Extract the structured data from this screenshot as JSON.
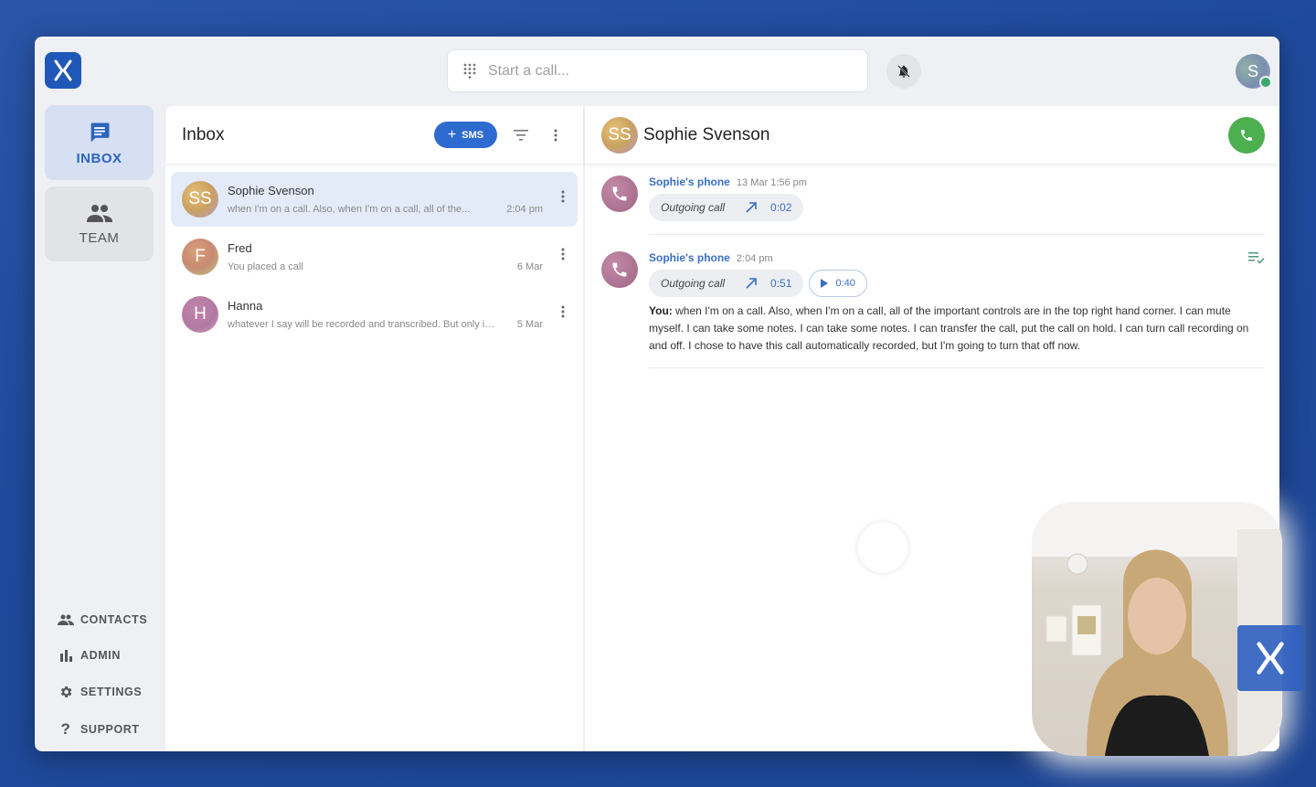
{
  "topbar": {
    "logo_letter": "X",
    "search_placeholder": "Start a call...",
    "user_initial": "S",
    "user_status": "online"
  },
  "colors": {
    "accent": "#2e6bd0",
    "call_green": "#4caf50",
    "presence_green": "#3aa86b",
    "background_blue": "#1f4a9c"
  },
  "nav": {
    "main": [
      {
        "label": "INBOX",
        "icon": "chat-icon",
        "active": true
      },
      {
        "label": "TEAM",
        "icon": "group-icon",
        "active": false
      }
    ],
    "bottom": [
      {
        "label": "CONTACTS",
        "icon": "contacts-icon"
      },
      {
        "label": "ADMIN",
        "icon": "bar-chart-icon"
      },
      {
        "label": "SETTINGS",
        "icon": "gear-icon"
      },
      {
        "label": "SUPPORT",
        "icon": "question-icon"
      }
    ]
  },
  "inbox": {
    "title": "Inbox",
    "sms_button": "SMS",
    "conversations": [
      {
        "initials": "SS",
        "name": "Sophie Svenson",
        "preview": "when I'm on a call. Also, when I'm on a call, all of the...",
        "time": "2:04 pm",
        "active": true
      },
      {
        "initials": "F",
        "name": "Fred",
        "preview": "You placed a call",
        "time": "6 Mar",
        "active": false
      },
      {
        "initials": "H",
        "name": "Hanna",
        "preview": "whatever I say will be recorded and transcribed. But only if I...",
        "time": "5 Mar",
        "active": false
      }
    ]
  },
  "chat": {
    "contact_initials": "SS",
    "contact_name": "Sophie Svenson",
    "messages": [
      {
        "sender": "Sophie's phone",
        "timestamp": "13 Mar 1:56 pm",
        "call_type": "Outgoing call",
        "duration": "0:02"
      },
      {
        "sender": "Sophie's phone",
        "timestamp": "2:04 pm",
        "call_type": "Outgoing call",
        "duration": "0:51",
        "recording_length": "0:40",
        "transcript_speaker": "You:",
        "transcript_text": "when I'm on a call. Also, when I'm on a call, all of the important controls are in the top right hand corner. I can mute myself. I can take some notes. I can take some notes. I can transfer the call, put the call on hold. I can turn call recording on and off. I chose to have this call automatically recorded, but I'm going to turn that off now."
      }
    ]
  },
  "overlay": {
    "brand_letter": "X"
  }
}
